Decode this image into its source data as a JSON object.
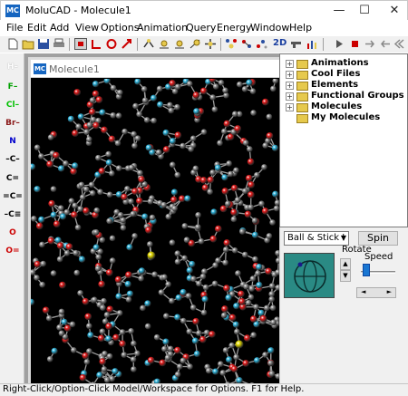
{
  "window": {
    "title": "MoluCAD - Molecule1",
    "minimize": "—",
    "maximize": "☐",
    "close": "✕",
    "app_icon": "MC"
  },
  "menu": [
    "File",
    "Edit",
    "Add",
    "View",
    "Options",
    "Animation",
    "Query",
    "Energy",
    "Window",
    "Help"
  ],
  "toolbar": {
    "items": [
      "new-file-icon",
      "open-folder-icon",
      "save-icon",
      "print-icon",
      "select-tool-icon",
      "move-tool-icon",
      "rotate-tool-icon",
      "zoom-tool-icon",
      "bond-tool-icon",
      "atom-a-icon",
      "atom-b-icon",
      "atom-c-icon",
      "atom-d-icon",
      "crosshair-icon",
      "molecule-view-icon",
      "ribbon-icon",
      "scatter-icon",
      "label-2d",
      "gun-icon",
      "chart-icon",
      "play-icon",
      "stop-icon",
      "forward-icon",
      "back-icon",
      "rewind-icon"
    ],
    "label_2d": "2D"
  },
  "palette": [
    {
      "label": "H–",
      "color": "#ffffff"
    },
    {
      "label": "F–",
      "color": "#00a000"
    },
    {
      "label": "Cl–",
      "color": "#00c000"
    },
    {
      "label": "Br–",
      "color": "#8b1a1a"
    },
    {
      "label": "N",
      "color": "#0000cc"
    },
    {
      "label": "–C–",
      "color": "#000000"
    },
    {
      "label": "C=",
      "color": "#000000"
    },
    {
      "label": "=C=",
      "color": "#000000"
    },
    {
      "label": "–C≡",
      "color": "#000000"
    },
    {
      "label": "O",
      "color": "#cc0000"
    },
    {
      "label": "O=",
      "color": "#cc0000"
    }
  ],
  "child_window": {
    "title": "Molecule1",
    "icon": "MC"
  },
  "tree": {
    "items": [
      {
        "label": "Animations",
        "expander": "+"
      },
      {
        "label": "Cool Files",
        "expander": "+"
      },
      {
        "label": "Elements",
        "expander": "+"
      },
      {
        "label": "Functional Groups",
        "expander": "+"
      },
      {
        "label": "Molecules",
        "expander": "+"
      },
      {
        "label": "My Molecules",
        "expander": ""
      }
    ]
  },
  "controls": {
    "render_mode": "Ball & Stick I",
    "spin_label": "Spin",
    "rotate_label": "Rotate",
    "speed_label": "Speed",
    "speed_level": 0.1
  },
  "status": {
    "text": "Right-Click/Option-Click Model/Workspace for Options.  F1 for Help."
  },
  "colors": {
    "carbon": "#8e8e8e",
    "oxygen": "#e41a1a",
    "nitrogen": "#2eb4dc",
    "sulfur": "#e6dc00",
    "background": "#000000",
    "rotate_widget": "#2a8a84"
  }
}
